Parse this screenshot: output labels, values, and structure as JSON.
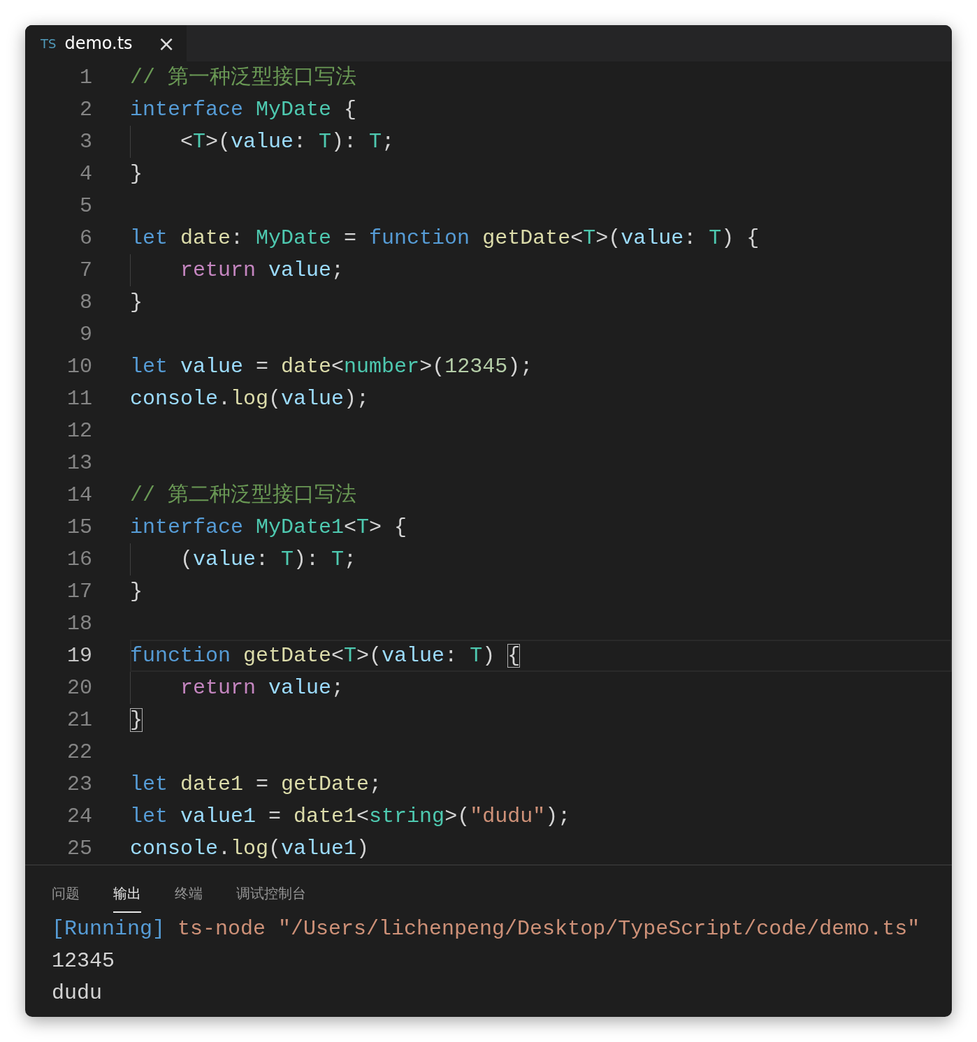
{
  "tabs": [
    {
      "label": "demo.ts",
      "badge": "TS",
      "selected": true,
      "close": "×"
    }
  ],
  "code": [
    {
      "number": "1",
      "current": false,
      "indented": false,
      "tokens": [
        {
          "kind": "comment",
          "text": "// 第一种泛型接口写法"
        }
      ]
    },
    {
      "number": "2",
      "current": false,
      "indented": false,
      "tokens": [
        {
          "kind": "keyword",
          "text": "interface"
        },
        {
          "kind": "type",
          "text": " MyDate"
        },
        {
          "kind": "plain",
          "text": " {"
        }
      ]
    },
    {
      "number": "3",
      "current": false,
      "indented": true,
      "tokens": [
        {
          "kind": "plain",
          "text": "<"
        },
        {
          "kind": "type",
          "text": "T"
        },
        {
          "kind": "plain",
          "text": ">("
        },
        {
          "kind": "var",
          "text": "value"
        },
        {
          "kind": "plain",
          "text": ": "
        },
        {
          "kind": "type",
          "text": "T"
        },
        {
          "kind": "plain",
          "text": "): "
        },
        {
          "kind": "type",
          "text": "T"
        },
        {
          "kind": "plain",
          "text": ";"
        }
      ]
    },
    {
      "number": "4",
      "current": false,
      "indented": false,
      "tokens": [
        {
          "kind": "plain",
          "text": "}"
        }
      ]
    },
    {
      "number": "5",
      "current": false
    },
    {
      "number": "6",
      "current": false,
      "indented": false,
      "tokens": [
        {
          "kind": "keyword",
          "text": "let"
        },
        {
          "kind": "func",
          "text": " date"
        },
        {
          "kind": "plain",
          "text": ": "
        },
        {
          "kind": "type",
          "text": "MyDate"
        },
        {
          "kind": "plain",
          "text": " = "
        },
        {
          "kind": "keyword",
          "text": "function"
        },
        {
          "kind": "func",
          "text": " getDate"
        },
        {
          "kind": "plain",
          "text": "<"
        },
        {
          "kind": "type",
          "text": "T"
        },
        {
          "kind": "plain",
          "text": ">("
        },
        {
          "kind": "var",
          "text": "value"
        },
        {
          "kind": "plain",
          "text": ": "
        },
        {
          "kind": "type",
          "text": "T"
        },
        {
          "kind": "plain",
          "text": ") {"
        }
      ]
    },
    {
      "number": "7",
      "current": false,
      "indented": true,
      "tokens": [
        {
          "kind": "control",
          "text": "return"
        },
        {
          "kind": "var",
          "text": " value"
        },
        {
          "kind": "plain",
          "text": ";"
        }
      ]
    },
    {
      "number": "8",
      "current": false,
      "indented": false,
      "tokens": [
        {
          "kind": "plain",
          "text": "}"
        }
      ]
    },
    {
      "number": "9",
      "current": false
    },
    {
      "number": "10",
      "current": false,
      "indented": false,
      "tokens": [
        {
          "kind": "keyword",
          "text": "let"
        },
        {
          "kind": "var",
          "text": " value"
        },
        {
          "kind": "plain",
          "text": " = "
        },
        {
          "kind": "func",
          "text": "date"
        },
        {
          "kind": "plain",
          "text": "<"
        },
        {
          "kind": "type",
          "text": "number"
        },
        {
          "kind": "plain",
          "text": ">("
        },
        {
          "kind": "number",
          "text": "12345"
        },
        {
          "kind": "plain",
          "text": ");"
        }
      ]
    },
    {
      "number": "11",
      "current": false,
      "indented": false,
      "tokens": [
        {
          "kind": "var",
          "text": "console"
        },
        {
          "kind": "plain",
          "text": "."
        },
        {
          "kind": "func",
          "text": "log"
        },
        {
          "kind": "plain",
          "text": "("
        },
        {
          "kind": "var",
          "text": "value"
        },
        {
          "kind": "plain",
          "text": ");"
        }
      ]
    },
    {
      "number": "12",
      "current": false
    },
    {
      "number": "13",
      "current": false
    },
    {
      "number": "14",
      "current": false,
      "indented": false,
      "tokens": [
        {
          "kind": "comment",
          "text": "// 第二种泛型接口写法"
        }
      ]
    },
    {
      "number": "15",
      "current": false,
      "indented": false,
      "tokens": [
        {
          "kind": "keyword",
          "text": "interface"
        },
        {
          "kind": "type",
          "text": " MyDate1"
        },
        {
          "kind": "plain",
          "text": "<"
        },
        {
          "kind": "type",
          "text": "T"
        },
        {
          "kind": "plain",
          "text": "> {"
        }
      ]
    },
    {
      "number": "16",
      "current": false,
      "indented": true,
      "tokens": [
        {
          "kind": "plain",
          "text": "("
        },
        {
          "kind": "var",
          "text": "value"
        },
        {
          "kind": "plain",
          "text": ": "
        },
        {
          "kind": "type",
          "text": "T"
        },
        {
          "kind": "plain",
          "text": "): "
        },
        {
          "kind": "type",
          "text": "T"
        },
        {
          "kind": "plain",
          "text": ";"
        }
      ]
    },
    {
      "number": "17",
      "current": false,
      "indented": false,
      "tokens": [
        {
          "kind": "plain",
          "text": "}"
        }
      ]
    },
    {
      "number": "18",
      "current": false
    },
    {
      "number": "19",
      "current": true,
      "indented": false,
      "tokens": [
        {
          "kind": "keyword",
          "text": "function"
        },
        {
          "kind": "func",
          "text": " getDate"
        },
        {
          "kind": "plain",
          "text": "<"
        },
        {
          "kind": "type",
          "text": "T"
        },
        {
          "kind": "plain",
          "text": ">("
        },
        {
          "kind": "var",
          "text": "value"
        },
        {
          "kind": "plain",
          "text": ": "
        },
        {
          "kind": "type",
          "text": "T"
        },
        {
          "kind": "plain",
          "text": ") "
        },
        {
          "kind": "bracket",
          "text": "{"
        }
      ]
    },
    {
      "number": "20",
      "current": false,
      "indented": true,
      "tokens": [
        {
          "kind": "control",
          "text": "return"
        },
        {
          "kind": "var",
          "text": " value"
        },
        {
          "kind": "plain",
          "text": ";"
        }
      ]
    },
    {
      "number": "21",
      "current": false,
      "indented": false,
      "tokens": [
        {
          "kind": "bracket",
          "text": "}"
        }
      ]
    },
    {
      "number": "22",
      "current": false
    },
    {
      "number": "23",
      "current": false,
      "indented": false,
      "tokens": [
        {
          "kind": "keyword",
          "text": "let"
        },
        {
          "kind": "func",
          "text": " date1"
        },
        {
          "kind": "plain",
          "text": " = "
        },
        {
          "kind": "func",
          "text": "getDate"
        },
        {
          "kind": "plain",
          "text": ";"
        }
      ]
    },
    {
      "number": "24",
      "current": false,
      "indented": false,
      "tokens": [
        {
          "kind": "keyword",
          "text": "let"
        },
        {
          "kind": "var",
          "text": " value1"
        },
        {
          "kind": "plain",
          "text": " = "
        },
        {
          "kind": "func",
          "text": "date1"
        },
        {
          "kind": "plain",
          "text": "<"
        },
        {
          "kind": "type",
          "text": "string"
        },
        {
          "kind": "plain",
          "text": ">("
        },
        {
          "kind": "string",
          "text": "\"dudu\""
        },
        {
          "kind": "plain",
          "text": ");"
        }
      ]
    },
    {
      "number": "25",
      "current": false,
      "indented": false,
      "tokens": [
        {
          "kind": "var",
          "text": "console"
        },
        {
          "kind": "plain",
          "text": "."
        },
        {
          "kind": "func",
          "text": "log"
        },
        {
          "kind": "plain",
          "text": "("
        },
        {
          "kind": "var",
          "text": "value1"
        },
        {
          "kind": "plain",
          "text": ")"
        }
      ]
    }
  ],
  "panel": {
    "tabs": [
      {
        "label": "问题",
        "selected": false
      },
      {
        "label": "输出",
        "selected": true
      },
      {
        "label": "终端",
        "selected": false
      },
      {
        "label": "调试控制台",
        "selected": false
      }
    ],
    "output": [
      [
        {
          "kind": "status",
          "text": "[Running]"
        },
        {
          "kind": "command",
          "text": " ts-node \"/Users/lichenpeng/Desktop/TypeScript/code/demo.ts\""
        }
      ],
      [
        {
          "kind": "plain",
          "text": "12345"
        }
      ],
      [
        {
          "kind": "plain",
          "text": "dudu"
        }
      ]
    ]
  }
}
